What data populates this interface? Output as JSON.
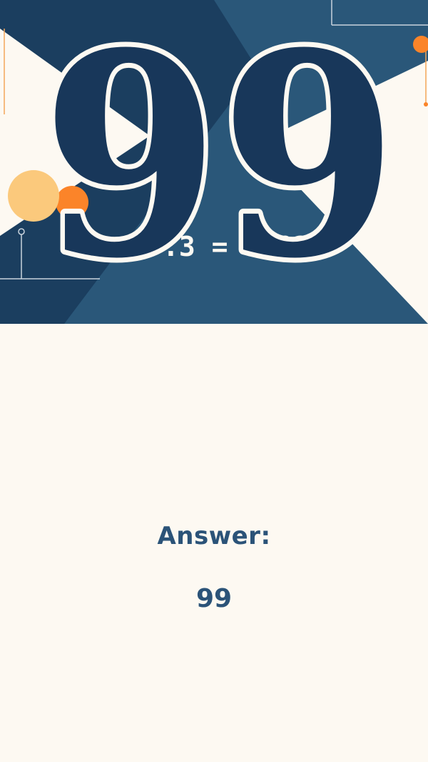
{
  "illustration": {
    "big_number": "99",
    "formula_text": ".3  =  970299",
    "colors": {
      "navy": "#1b3e5f",
      "steel_blue": "#2a5779",
      "cream": "#fdf9f2",
      "orange": "#fb8429",
      "peach": "#fbc97c"
    }
  },
  "answer": {
    "label": "Answer:",
    "value": "99"
  }
}
